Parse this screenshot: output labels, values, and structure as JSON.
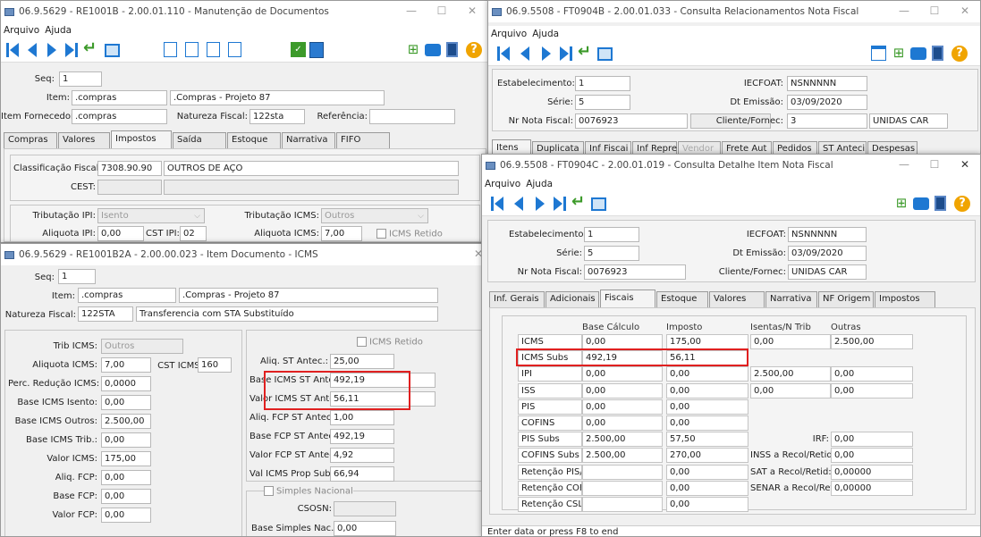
{
  "w1": {
    "title": "06.9.5629 - RE1001B - 2.00.01.110 - Manutenção de Documentos",
    "menu": [
      "Arquivo",
      "Ajuda"
    ],
    "seq_label": "Seq:",
    "seq": "1",
    "item_label": "Item:",
    "item": ".compras",
    "item_desc": ".Compras - Projeto 87",
    "fornec_label": "Item Fornecedor:",
    "fornec": ".compras",
    "natureza_label": "Natureza Fiscal:",
    "natureza": "122sta",
    "referencia_label": "Referência:",
    "tabs": [
      "Compras",
      "Valores",
      "Impostos",
      "Saída",
      "Estoque",
      "Narrativa",
      "FIFO"
    ],
    "class_label": "Classificação Fiscal:",
    "class": "7308.90.90",
    "class_desc": "OUTROS DE AÇO",
    "cest_label": "CEST:",
    "trib_ipi_label": "Tributação IPI:",
    "trib_ipi": "Isento",
    "trib_icms_label": "Tributação ICMS:",
    "trib_icms": "Outros",
    "aliq_ipi_label": "Aliquota IPI:",
    "aliq_ipi": "0,00",
    "cst_ipi_label": "CST IPI:",
    "cst_ipi": "02",
    "aliq_icms_label": "Aliquota ICMS:",
    "aliq_icms": "7,00",
    "icms_retido": "ICMS Retido"
  },
  "w2": {
    "title": "06.9.5629 - RE1001B2A - 2.00.00.023 - Item Documento - ICMS",
    "seq_label": "Seq:",
    "seq": "1",
    "item_label": "Item:",
    "item": ".compras",
    "item_desc": ".Compras - Projeto 87",
    "natureza_label": "Natureza Fiscal:",
    "natureza": "122STA",
    "natureza_desc": "Transferencia com STA Substituído",
    "left": [
      {
        "label": "Trib ICMS:",
        "value": "Outros"
      },
      {
        "label": "Aliquota ICMS:",
        "value": "7,00"
      },
      {
        "label": "Perc. Redução ICMS:",
        "value": "0,0000"
      },
      {
        "label": "Base ICMS Isento:",
        "value": "0,00"
      },
      {
        "label": "Base ICMS Outros:",
        "value": "2.500,00"
      },
      {
        "label": "Base ICMS Trib.:",
        "value": "0,00"
      },
      {
        "label": "Valor ICMS:",
        "value": "175,00"
      },
      {
        "label": "Aliq. FCP:",
        "value": "0,00"
      },
      {
        "label": "Base FCP:",
        "value": "0,00"
      },
      {
        "label": "Valor FCP:",
        "value": "0,00"
      }
    ],
    "cst_icms_label": "CST ICMS:",
    "cst_icms": "160",
    "icms_retido": "ICMS Retido",
    "right": [
      {
        "label": "Aliq. ST Antec.:",
        "value": "25,00"
      },
      {
        "label": "Base ICMS ST Antec.:",
        "value": "492,19"
      },
      {
        "label": "Valor ICMS ST Antec.:",
        "value": "56,11"
      },
      {
        "label": "Aliq. FCP ST Antec.:",
        "value": "1,00"
      },
      {
        "label": "Base FCP ST Antec.:",
        "value": "492,19"
      },
      {
        "label": "Valor FCP ST Antec.:",
        "value": "4,92"
      },
      {
        "label": "Val ICMS Prop Subs:",
        "value": "66,94"
      }
    ],
    "simples": "Simples Nacional",
    "csosn_label": "CSOSN:",
    "base_simples_label": "Base Simples Nac.:",
    "base_simples": "0,00"
  },
  "w3": {
    "title": "06.9.5508 - FT0904B - 2.00.01.033 - Consulta Relacionamentos Nota Fiscal",
    "menu": [
      "Arquivo",
      "Ajuda"
    ],
    "estab_label": "Estabelecimento:",
    "estab": "1",
    "iecfoat_label": "IECFOAT:",
    "iecfoat": "NSNNNNN",
    "serie_label": "Série:",
    "serie": "5",
    "dtemissao_label": "Dt Emissão:",
    "dtemissao": "03/09/2020",
    "nrnota_label": "Nr Nota Fiscal:",
    "nrnota": "0076923",
    "cliente_label": "Cliente/Fornec:",
    "cliente": "3",
    "cliente_nome": "UNIDAS CAR",
    "tabs": [
      "Itens",
      "Duplicata",
      "Inf Fiscai",
      "Inf Repre",
      "Vendor",
      "Frete Aut",
      "Pedidos",
      "ST Anteci",
      "Despesas"
    ]
  },
  "w4": {
    "title": "06.9.5508 - FT0904C - 2.00.01.019 - Consulta Detalhe Item Nota Fiscal",
    "menu": [
      "Arquivo",
      "Ajuda"
    ],
    "estab_label": "Estabelecimento:",
    "estab": "1",
    "iecfoat_label": "IECFOAT:",
    "iecfoat": "NSNNNNN",
    "serie_label": "Série:",
    "serie": "5",
    "dtemissao_label": "Dt Emissão:",
    "dtemissao": "03/09/2020",
    "nrnota_label": "Nr Nota Fiscal:",
    "nrnota": "0076923",
    "cliente_label": "Cliente/Fornec:",
    "cliente": "UNIDAS CAR",
    "tabs": [
      "Inf. Gerais",
      "Adicionais",
      "Fiscais",
      "Estoque",
      "Valores",
      "Narrativa",
      "NF Origem",
      "Impostos"
    ],
    "headers": [
      "Base Cálculo",
      "Imposto",
      "Isentas/N Trib",
      "Outras"
    ],
    "rows": [
      {
        "name": "ICMS",
        "base": "0,00",
        "imposto": "175,00",
        "isentas": "0,00",
        "outras": "2.500,00"
      },
      {
        "name": "ICMS Subs",
        "base": "492,19",
        "imposto": "56,11"
      },
      {
        "name": "IPI",
        "base": "0,00",
        "imposto": "0,00",
        "isentas": "2.500,00",
        "outras": "0,00"
      },
      {
        "name": "ISS",
        "base": "0,00",
        "imposto": "0,00",
        "isentas": "0,00",
        "outras": "0,00"
      },
      {
        "name": "PIS",
        "base": "0,00",
        "imposto": "0,00"
      },
      {
        "name": "COFINS",
        "base": "0,00",
        "imposto": "0,00"
      },
      {
        "name": "PIS Subs",
        "base": "2.500,00",
        "imposto": "57,50"
      },
      {
        "name": "COFINS Subs",
        "base": "2.500,00",
        "imposto": "270,00"
      },
      {
        "name": "Retenção PIS/PASEP",
        "imposto": "0,00"
      },
      {
        "name": "Retenção COFINS",
        "imposto": "0,00"
      },
      {
        "name": "Retenção CSLL",
        "imposto": "0,00"
      }
    ],
    "side": [
      {
        "label": "IRF:",
        "value": "0,00"
      },
      {
        "label": "INSS a Recol/Retid:",
        "value": "0,00"
      },
      {
        "label": "SAT a Recol/Retid:",
        "value": "0,00000"
      },
      {
        "label": "SENAR a Recol/Retid:",
        "value": "0,00000"
      }
    ],
    "status": "Enter data or press F8 to end"
  },
  "highlight_color": "#e02020"
}
